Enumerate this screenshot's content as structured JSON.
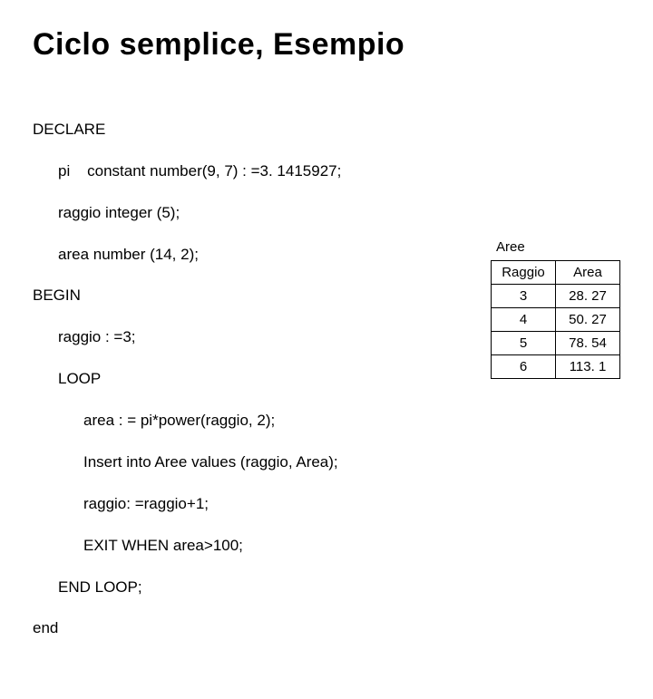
{
  "title": "Ciclo semplice, Esempio",
  "code": {
    "l1": "DECLARE",
    "l2": "pi    constant number(9, 7) : =3. 1415927;",
    "l3": "raggio integer (5);",
    "l4": "area number (14, 2);",
    "l5": "BEGIN",
    "l6": "raggio : =3;",
    "l7": "LOOP",
    "l8": "area : = pi*power(raggio, 2);",
    "l9": "Insert into Aree values (raggio, Area);",
    "l10": "raggio: =raggio+1;",
    "l11": "EXIT WHEN area>100;",
    "l12": "END LOOP;",
    "l13": "end"
  },
  "table": {
    "caption": "Aree",
    "headers": {
      "c1": "Raggio",
      "c2": "Area"
    },
    "rows": [
      {
        "raggio": "3",
        "area": "28. 27"
      },
      {
        "raggio": "4",
        "area": "50. 27"
      },
      {
        "raggio": "5",
        "area": "78. 54"
      },
      {
        "raggio": "6",
        "area": "113. 1"
      }
    ]
  }
}
